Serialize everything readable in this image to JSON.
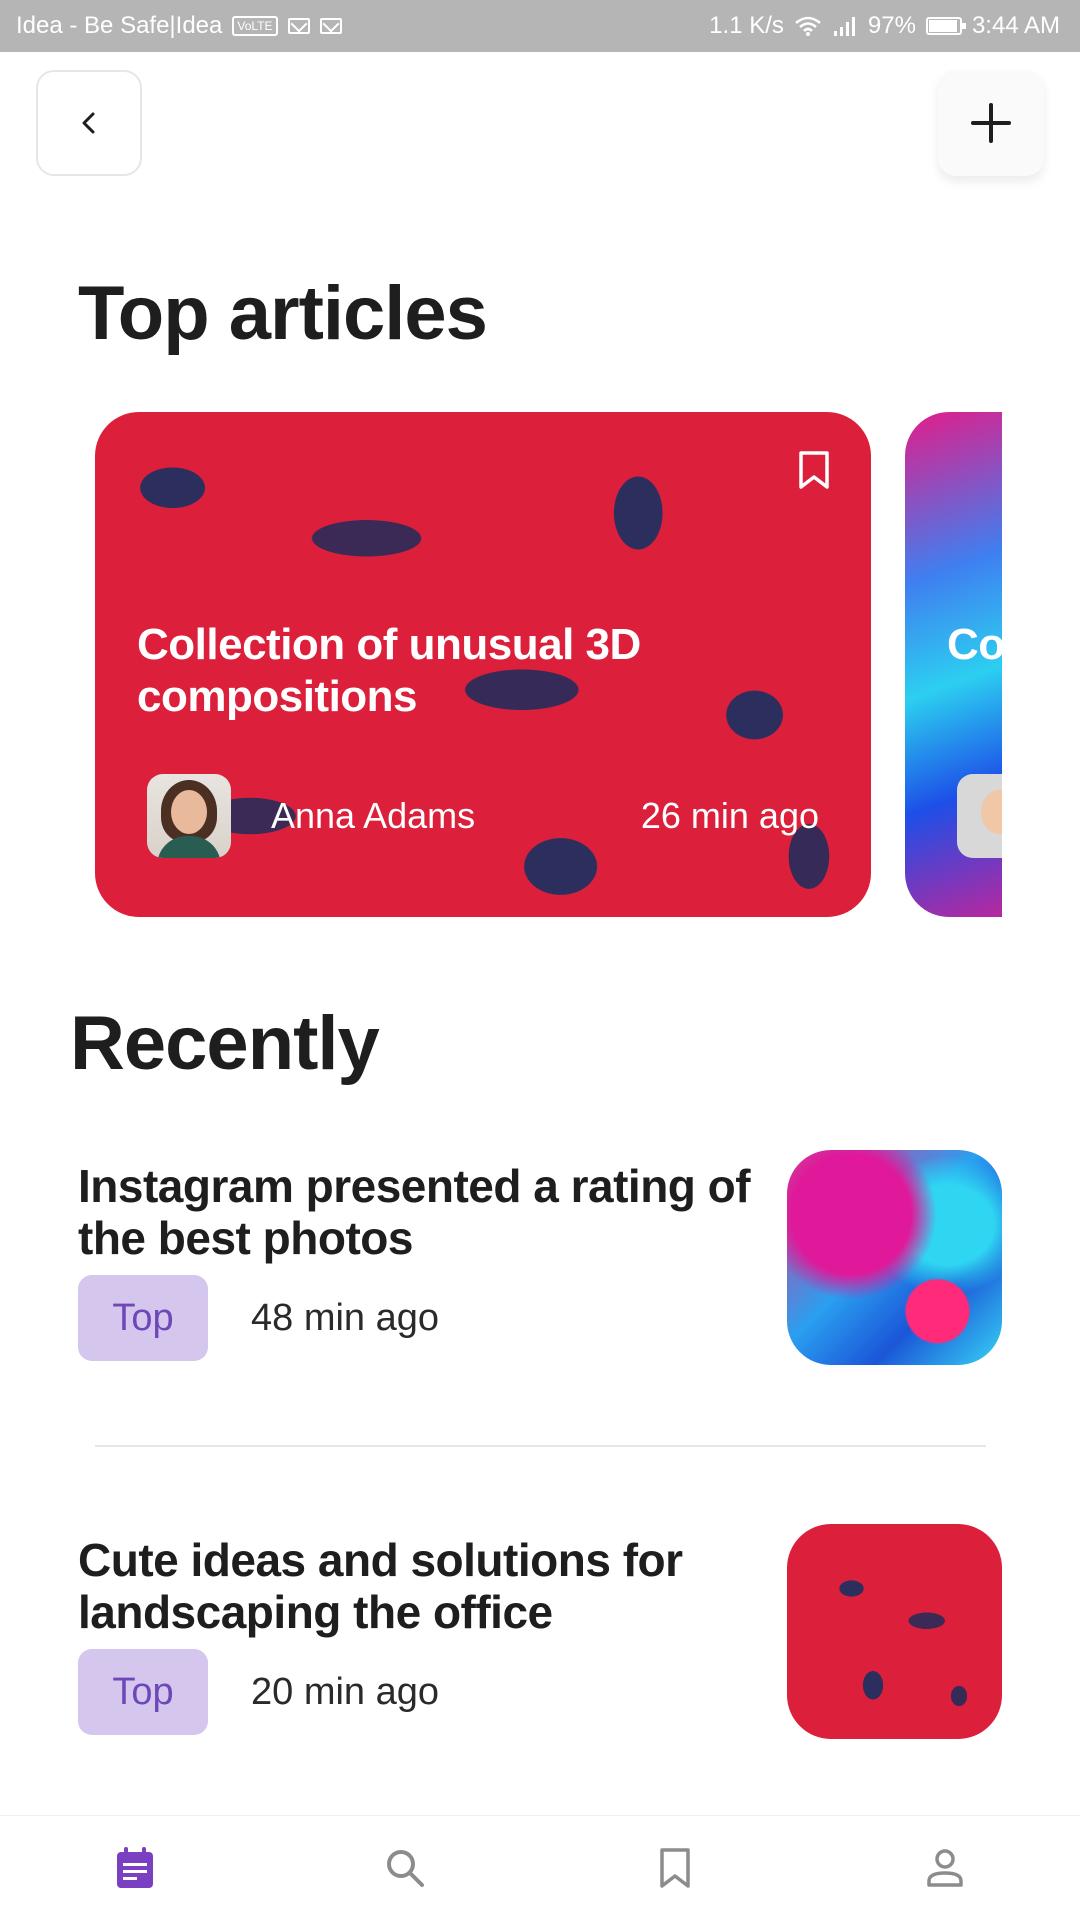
{
  "status_bar": {
    "carrier": "Idea - Be Safe|Idea",
    "volte": "VoLTE",
    "speed": "1.1 K/s",
    "battery": "97%",
    "time": "3:44 AM"
  },
  "header": {
    "back_icon": "chevron-left-icon",
    "add_icon": "plus-icon"
  },
  "top_articles": {
    "heading": "Top articles",
    "cards": [
      {
        "title": "Collection of unusual 3D compositions",
        "author": "Anna Adams",
        "time": "26 min ago",
        "bookmark_icon": "bookmark-icon"
      },
      {
        "title": "Co co",
        "author": "",
        "time": ""
      }
    ]
  },
  "recently": {
    "heading": "Recently",
    "items": [
      {
        "title": "Instagram presented a rating of the best photos",
        "tag": "Top",
        "time": "48 min ago"
      },
      {
        "title": "Cute ideas and solutions for landscaping the office",
        "tag": "Top",
        "time": "20 min ago"
      }
    ]
  },
  "bottom_nav": {
    "items": [
      {
        "icon": "calendar-icon",
        "active": true
      },
      {
        "icon": "search-icon",
        "active": false
      },
      {
        "icon": "bookmark-icon",
        "active": false
      },
      {
        "icon": "profile-icon",
        "active": false
      }
    ]
  },
  "colors": {
    "accent": "#7b3fc1",
    "tag_bg": "#d4c6ec",
    "tag_text": "#6e47b8",
    "card_red": "#dc1f3a"
  }
}
